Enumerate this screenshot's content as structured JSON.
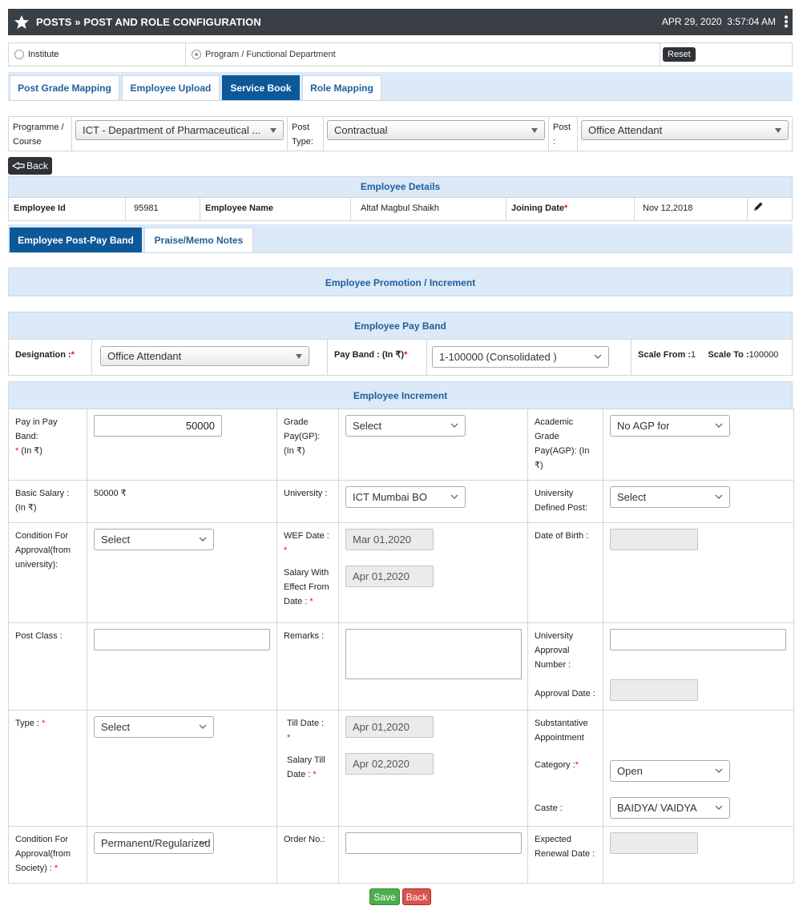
{
  "header": {
    "title": "POSTS » POST AND ROLE CONFIGURATION",
    "date": "APR 29, 2020",
    "time": "3:57:04 AM"
  },
  "radios": {
    "institute": "Institute",
    "program": "Program / Functional Department",
    "reset": "Reset"
  },
  "tabs": [
    "Post Grade Mapping",
    "Employee Upload",
    "Service Book",
    "Role Mapping"
  ],
  "filters": {
    "programme_label": "Programme / Course",
    "programme_value": "ICT - Department of Pharmaceutical ...",
    "post_type_label": "Post Type:",
    "post_type_value": "Contractual",
    "post_label": "Post :",
    "post_value": "Office Attendant"
  },
  "back_label": "Back",
  "employee_details": {
    "heading": "Employee Details",
    "id_label": "Employee Id",
    "id_value": "95981",
    "name_label": "Employee Name",
    "name_value": "Altaf Magbul Shaikh",
    "joining_label": "Joining Date",
    "joining_value": "Nov 12,2018"
  },
  "subtabs": [
    "Employee Post-Pay Band",
    "Praise/Memo Notes"
  ],
  "promotion_heading": "Employee Promotion / Increment",
  "pay_band": {
    "heading": "Employee Pay Band",
    "designation_label": "Designation :",
    "designation_value": "Office Attendant",
    "payband_label": "Pay Band : (In ₹)",
    "payband_value": "1-100000 (Consolidated )",
    "scale_from_label": "Scale From :",
    "scale_from_value": "1",
    "scale_to_label": "Scale To :",
    "scale_to_value": "100000"
  },
  "increment": {
    "heading": "Employee Increment",
    "pay_in_band_label": "Pay in Pay Band:",
    "pay_in_band_unit": "(In ₹)",
    "pay_in_band_value": "50000",
    "grade_pay_label": "Grade Pay(GP): (In ₹)",
    "grade_pay_value": "Select",
    "agp_label": "Academic Grade Pay(AGP): (In ₹)",
    "agp_value": "No AGP for",
    "basic_salary_label": "Basic Salary : (In ₹)",
    "basic_salary_value": "50000 ₹",
    "university_label": "University :",
    "university_value": "ICT Mumbai BO",
    "univ_post_label": "University Defined Post:",
    "univ_post_value": "Select",
    "cond_univ_label": "Condition For Approval(from university):",
    "cond_univ_value": "Select",
    "wef_label": "WEF Date :",
    "wef_value": "Mar 01,2020",
    "salary_wef_label": "Salary With Effect From Date :",
    "salary_wef_value": "Apr 01,2020",
    "dob_label": "Date of Birth :",
    "dob_value": "",
    "post_class_label": "Post Class :",
    "post_class_value": "",
    "remarks_label": "Remarks :",
    "remarks_value": "",
    "univ_approval_label": "University Approval Number :",
    "univ_approval_value": "",
    "approval_date_label": "Approval Date :",
    "approval_date_value": "",
    "type_label": "Type :",
    "type_value": "Select",
    "till_label": "Till Date :",
    "till_value": "Apr 01,2020",
    "salary_till_label": "Salary Till Date :",
    "salary_till_value": "Apr 02,2020",
    "subst_label": "Substantative Appointment",
    "category_label": "Category :",
    "category_value": "Open",
    "caste_label": "Caste :",
    "caste_value": "BAIDYA/ VAIDYA",
    "cond_soc_label": "Condition For Approval(from Society) :",
    "cond_soc_value": "Permanent/Regularized",
    "order_label": "Order No.:",
    "order_value": "",
    "renewal_label": "Expected Renewal Date :",
    "renewal_value": ""
  },
  "actions": {
    "save": "Save",
    "back": "Back"
  },
  "colors": {
    "header_bg": "#3a3f46",
    "tab_active": "#0d5899",
    "section_bg": "#dce9f7",
    "save": "#4cae4c",
    "back": "#d9534f"
  }
}
